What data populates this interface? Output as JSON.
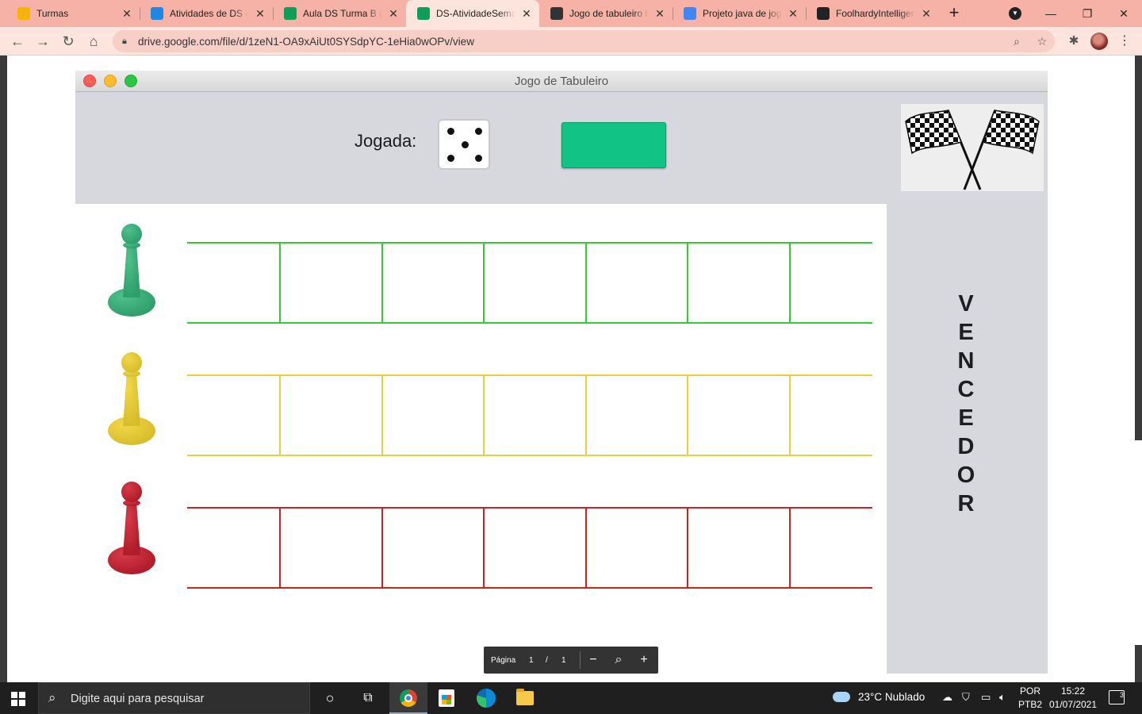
{
  "browser": {
    "tabs": [
      {
        "title": "Turmas",
        "icon": "google-classroom-icon",
        "color": "#f4b400",
        "active": false
      },
      {
        "title": "Atividades de DS - ",
        "icon": "google-classroom-icon",
        "color": "#1e88e5",
        "active": false
      },
      {
        "title": "Aula DS Turma B (S",
        "icon": "google-drive-icon",
        "color": "#0f9d58",
        "active": false
      },
      {
        "title": "DS-AtividadeSeman",
        "icon": "google-drive-icon",
        "color": "#0f9d58",
        "active": true
      },
      {
        "title": "Jogo de tabuleiro i",
        "icon": "site-icon",
        "color": "#333333",
        "active": false
      },
      {
        "title": "Projeto java de jog",
        "icon": "google-icon",
        "color": "#4285f4",
        "active": false
      },
      {
        "title": "FoolhardyIntelligen",
        "icon": "replit-icon",
        "color": "#222222",
        "active": false
      }
    ],
    "new_tab_symbol": "+",
    "url": "drive.google.com/file/d/1zeN1-OA9xAiUt0SYSdpYC-1eHia0wOPv/view",
    "window_controls": {
      "minimize": "—",
      "restore": "❐",
      "close": "✕"
    }
  },
  "app": {
    "window_title": "Jogo de Tabuleiro",
    "jogada_label": "Jogada:",
    "dice_value": 5,
    "vencedor_letters": [
      "V",
      "E",
      "N",
      "C",
      "E",
      "D",
      "O",
      "R"
    ],
    "players": [
      {
        "name": "green",
        "color": "#2e9e6a",
        "light": "#4fc18c",
        "track_color": "#33cc33"
      },
      {
        "name": "yellow",
        "color": "#d8bd2a",
        "light": "#f0d74a",
        "track_color": "#e8d23a"
      },
      {
        "name": "red",
        "color": "#b01c2a",
        "light": "#d63a48",
        "track_color": "#cc2222"
      }
    ],
    "cells_per_track": 7,
    "accent_button_color": "#12c386"
  },
  "pdf_controls": {
    "page_label": "Página",
    "current_page": "1",
    "separator": "/",
    "total_pages": "1",
    "zoom_out": "−",
    "zoom_in": "+"
  },
  "taskbar": {
    "search_placeholder": "Digite aqui para pesquisar",
    "weather": "23°C  Nublado",
    "lang_top": "POR",
    "lang_bottom": "PTB2",
    "time": "15:22",
    "date": "01/07/2021",
    "notifications": "3"
  }
}
